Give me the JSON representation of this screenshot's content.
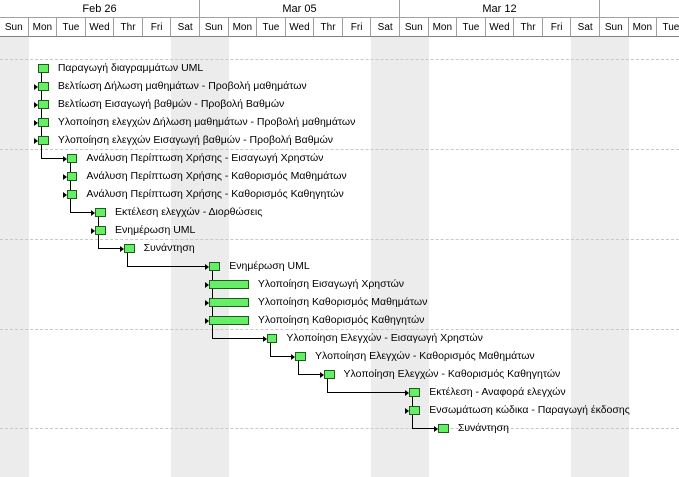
{
  "weeks": [
    "Feb 26",
    "Mar 05",
    "Mar 12",
    ""
  ],
  "days": [
    "Sun",
    "Mon",
    "Tue",
    "Wed",
    "Thr",
    "Fri",
    "Sat",
    "Sun",
    "Mon",
    "Tue",
    "Wed",
    "Thr",
    "Fri",
    "Sat",
    "Sun",
    "Mon",
    "Tue",
    "Wed",
    "Thr",
    "Fri",
    "Sat",
    "Sun",
    "Mon",
    "Tue"
  ],
  "tasks": [
    {
      "label": "Παραγωγή διαγραμμάτων UML",
      "start_day": 1.33,
      "end_day": 1.71
    },
    {
      "label": "Βελτίωση Δήλωση μαθημάτων - Προβολή μαθημάτων",
      "start_day": 1.33,
      "end_day": 1.71
    },
    {
      "label": "Βελτίωση Εισαγωγή βαθμών - Προβολή Βαθμών",
      "start_day": 1.33,
      "end_day": 1.71
    },
    {
      "label": "Υλοποίηση ελεγχών Δήλωση μαθημάτων - Προβολή μαθημάτων",
      "start_day": 1.33,
      "end_day": 1.71
    },
    {
      "label": "Υλοποίηση ελεγχών Εισαγωγή βαθμών - Προβολή Βαθμών",
      "start_day": 1.33,
      "end_day": 1.71
    },
    {
      "label": "Ανάλυση Περίπτωση Χρήσης - Εισαγωγή Χρηστών",
      "start_day": 2.33,
      "end_day": 2.71
    },
    {
      "label": "Ανάλυση Περίπτωση Χρήσης - Καθορισμός Μαθημάτων",
      "start_day": 2.33,
      "end_day": 2.71
    },
    {
      "label": "Ανάλυση Περίπτωση Χρήσης - Καθορισμός Καθηγητών",
      "start_day": 2.33,
      "end_day": 2.71
    },
    {
      "label": "Εκτέλεση ελεγχών - Διορθώσεις",
      "start_day": 3.33,
      "end_day": 3.71
    },
    {
      "label": "Ενημέρωση UML",
      "start_day": 3.33,
      "end_day": 3.71
    },
    {
      "label": "Συνάντηση",
      "start_day": 4.33,
      "end_day": 4.71
    },
    {
      "label": "Ενημέρωση UML",
      "start_day": 7.33,
      "end_day": 7.71
    },
    {
      "label": "Υλοποίηση Εισαγωγή Χρηστών",
      "start_day": 7.33,
      "end_day": 8.71
    },
    {
      "label": "Υλοποίηση Καθορισμός Μαθημάτων",
      "start_day": 7.33,
      "end_day": 8.71
    },
    {
      "label": "Υλοποίηση Καθορισμός Καθηγητών",
      "start_day": 7.33,
      "end_day": 8.71
    },
    {
      "label": "Υλοποίηση Ελεγχών -  Εισαγωγή Χρηστών",
      "start_day": 9.33,
      "end_day": 9.71
    },
    {
      "label": "Υλοποίηση Ελεγχών - Καθορισμός Μαθημάτων",
      "start_day": 10.33,
      "end_day": 10.71
    },
    {
      "label": "Υλοποίηση Ελεγχών  - Καθορισμός Καθηγητών",
      "start_day": 11.33,
      "end_day": 11.71
    },
    {
      "label": "Εκτέλεση - Αναφορά ελεγχών",
      "start_day": 14.33,
      "end_day": 14.71
    },
    {
      "label": "Ενσωμάτωση κώδικα - Παραγωγή έκδοσης",
      "start_day": 14.33,
      "end_day": 14.71
    },
    {
      "label": "Συνάντηση",
      "start_day": 15.33,
      "end_day": 15.71
    }
  ],
  "links": [
    [
      0,
      1
    ],
    [
      1,
      2
    ],
    [
      2,
      3
    ],
    [
      3,
      4
    ],
    [
      4,
      5
    ],
    [
      5,
      6
    ],
    [
      6,
      7
    ],
    [
      7,
      8
    ],
    [
      8,
      9
    ],
    [
      9,
      10
    ],
    [
      10,
      11
    ],
    [
      11,
      12
    ],
    [
      11,
      13
    ],
    [
      11,
      14
    ],
    [
      14,
      15
    ],
    [
      15,
      16
    ],
    [
      16,
      17
    ],
    [
      17,
      18
    ],
    [
      18,
      19
    ],
    [
      19,
      20
    ]
  ],
  "colors": {
    "bar_fill": "#66ee66",
    "bar_border": "#1c5c1c",
    "weekend": "#ececec",
    "grid": "#a0a0a0"
  }
}
